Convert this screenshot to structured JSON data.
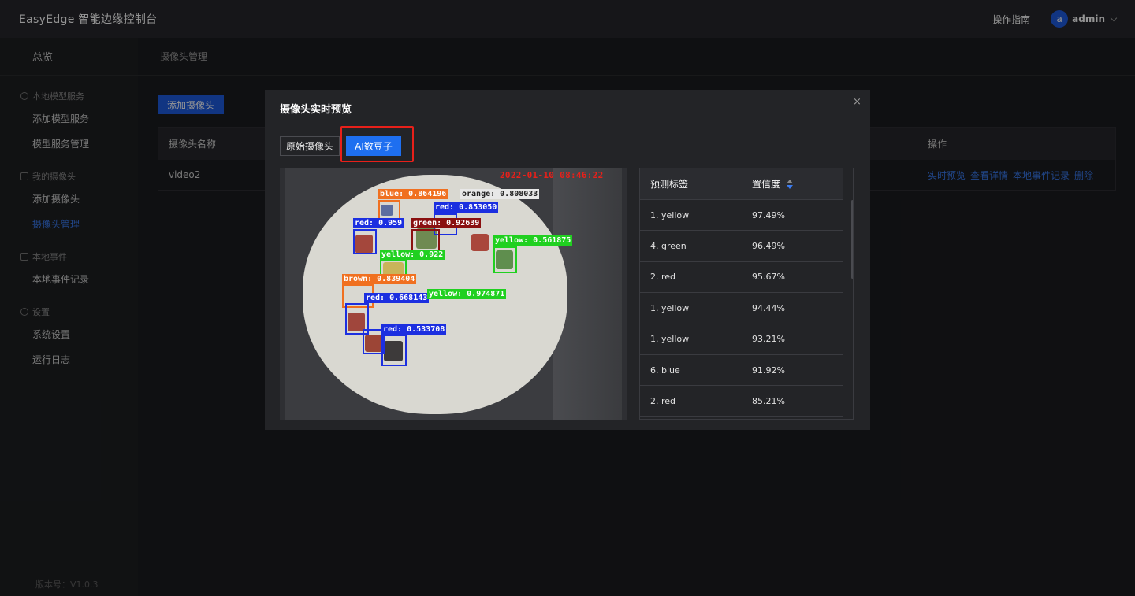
{
  "header": {
    "brand": "EasyEdge 智能边缘控制台",
    "guide": "操作指南",
    "avatar_letter": "a",
    "user": "admin"
  },
  "sidebar": {
    "overview": "总览",
    "groups": [
      {
        "title": "本地模型服务",
        "items": [
          "添加模型服务",
          "模型服务管理"
        ]
      },
      {
        "title": "我的摄像头",
        "items": [
          "添加摄像头",
          "摄像头管理"
        ]
      },
      {
        "title": "本地事件",
        "items": [
          "本地事件记录"
        ]
      },
      {
        "title": "设置",
        "items": [
          "系统设置",
          "运行日志"
        ]
      }
    ],
    "active_item": "摄像头管理",
    "version": "版本号：V1.0.3"
  },
  "main": {
    "breadcrumb": "摄像头管理",
    "add_button": "添加摄像头",
    "table": {
      "col_name": "摄像头名称",
      "col_ops": "操作",
      "rows": [
        {
          "name": "video2",
          "ops": [
            "实时预览",
            "查看详情",
            "本地事件记录",
            "删除"
          ]
        }
      ]
    }
  },
  "modal": {
    "title": "摄像头实时预览",
    "close": "×",
    "tab_raw": "原始摄像头",
    "tab_ai": "AI数豆子",
    "video": {
      "timestamp": "2022-01-10 08:46:22",
      "detections": [
        {
          "label": "blue: 0.864196",
          "color": "#f07020"
        },
        {
          "label": "orange: 0.808033",
          "color": "#f0f0f0"
        },
        {
          "label": "red: 0.853050",
          "color": "#1c2fe0"
        },
        {
          "label": "red: 0.959",
          "color": "#1c2fe0"
        },
        {
          "label": "green: 0.92639",
          "color": "#8a1010"
        },
        {
          "label": "yellow: 0.561875",
          "color": "#20d020"
        },
        {
          "label": "yellow: 0.922",
          "color": "#20d020"
        },
        {
          "label": "brown: 0.839404",
          "color": "#f07020"
        },
        {
          "label": "red: 0.668143",
          "color": "#1c2fe0"
        },
        {
          "label": "yellow: 0.974871",
          "color": "#20d020"
        },
        {
          "label": "red: 0.533708",
          "color": "#1c2fe0"
        }
      ]
    },
    "results": {
      "col_label": "预测标签",
      "col_conf": "置信度",
      "rows": [
        {
          "label": "1. yellow",
          "conf": "97.49%"
        },
        {
          "label": "4. green",
          "conf": "96.49%"
        },
        {
          "label": "2. red",
          "conf": "95.67%"
        },
        {
          "label": "1. yellow",
          "conf": "94.44%"
        },
        {
          "label": "1. yellow",
          "conf": "93.21%"
        },
        {
          "label": "6. blue",
          "conf": "91.92%"
        },
        {
          "label": "2. red",
          "conf": "85.21%"
        }
      ]
    }
  },
  "colors": {
    "accent": "#1e6ff0",
    "link": "#3a7bf0",
    "highlight": "#e8201a"
  }
}
